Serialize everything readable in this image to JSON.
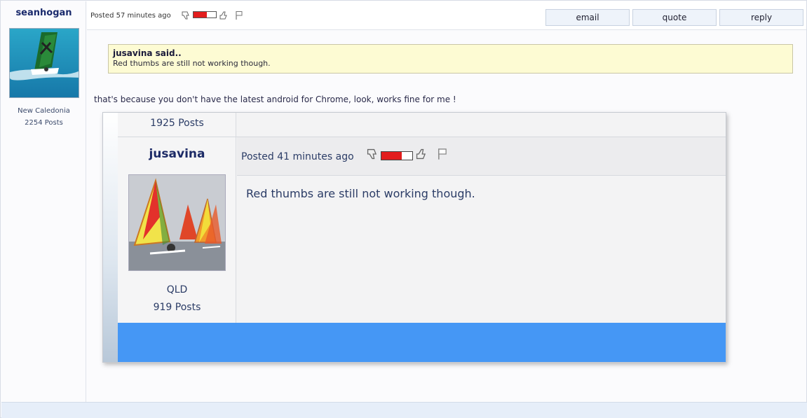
{
  "post": {
    "author": "seanhogan",
    "location": "New Caledonia",
    "post_count": "2254 Posts",
    "posted": "Posted 57 minutes ago",
    "rating_fill_fraction": 0.6,
    "actions": {
      "email": "email",
      "quote": "quote",
      "reply": "reply"
    },
    "quote": {
      "author": "jusavina said..",
      "text": "Red thumbs are still not working though."
    },
    "body": "that's because you don't have the latest android for Chrome, look, works fine for me !"
  },
  "embedded_screenshot": {
    "previous_post_count": "1925 Posts",
    "author": "jusavina",
    "posted": "Posted 41 minutes ago",
    "location": "QLD",
    "post_count": "919 Posts",
    "message": "Red thumbs are still not working though.",
    "rating_fill_fraction": 0.65,
    "accent_color": "#4597f5"
  },
  "colors": {
    "rating_red": "#e21d1d",
    "quote_background": "#fdfbd3",
    "username_blue": "#1a2a6c"
  }
}
